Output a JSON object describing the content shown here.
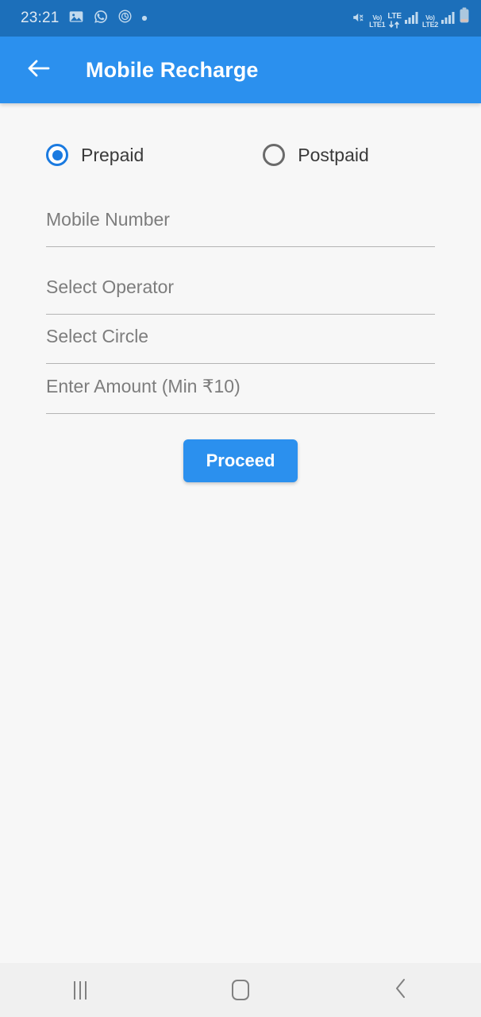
{
  "status_bar": {
    "time": "23:21",
    "left_icons": [
      "image-icon",
      "whatsapp-icon",
      "clock-icon",
      "dot-icon"
    ],
    "right_icons": [
      "mute-icon",
      "volte-lte1-icon",
      "lte-arrows-icon",
      "signal-bars-icon",
      "volte-lte2-icon",
      "signal-bars-2-icon",
      "battery-icon"
    ],
    "volte_sim1_top": "Vo)",
    "volte_sim1_bottom": "LTE1",
    "lte_label": "LTE",
    "volte_sim2_top": "Vo)",
    "volte_sim2_bottom": "LTE2",
    "background_color": "#1c6fba"
  },
  "app_bar": {
    "back_icon": "arrow-left-icon",
    "title": "Mobile Recharge",
    "background_color": "#2b90ee",
    "text_color": "#ffffff"
  },
  "form": {
    "connection_type": {
      "selected": "Prepaid",
      "options": [
        {
          "label": "Prepaid",
          "selected": true
        },
        {
          "label": "Postpaid",
          "selected": false
        }
      ]
    },
    "fields": [
      {
        "name": "mobile-number",
        "placeholder": "Mobile Number",
        "value": ""
      },
      {
        "name": "select-operator",
        "placeholder": "Select Operator",
        "value": ""
      },
      {
        "name": "select-circle",
        "placeholder": "Select Circle",
        "value": ""
      },
      {
        "name": "enter-amount",
        "placeholder": "Enter Amount (Min ₹10)",
        "value": ""
      }
    ],
    "submit_label": "Proceed",
    "accent_color": "#2b90ee",
    "placeholder_color": "#7d7d7d"
  },
  "nav_bar": {
    "recents_icon": "recents-icon",
    "home_icon": "home-icon",
    "back_icon": "back-chevron-icon",
    "background_color": "#f0f0f0"
  }
}
